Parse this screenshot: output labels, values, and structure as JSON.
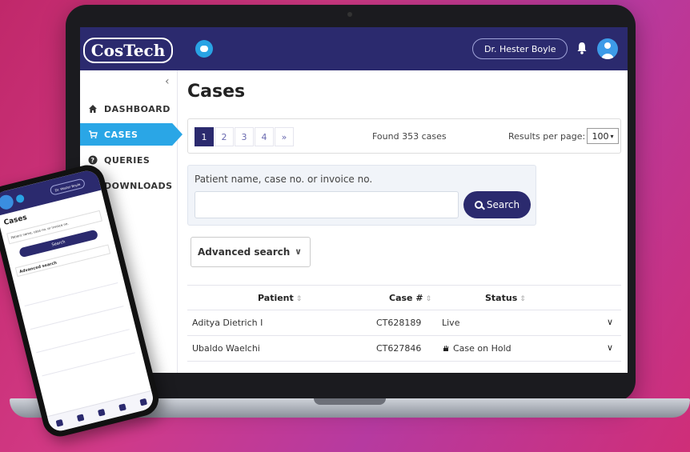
{
  "header": {
    "logo_text": "CosTech",
    "user_name": "Dr. Hester Boyle"
  },
  "sidebar": {
    "collapse_glyph": "‹",
    "items": [
      {
        "label": "DASHBOARD",
        "icon": "home-icon"
      },
      {
        "label": "CASES",
        "icon": "cart-icon",
        "active": true
      },
      {
        "label": "QUERIES",
        "icon": "question-icon"
      },
      {
        "label": "DOWNLOADS",
        "icon": "download-icon"
      }
    ]
  },
  "main": {
    "title": "Cases",
    "pagination": {
      "pages": [
        "1",
        "2",
        "3",
        "4",
        "»"
      ],
      "current": "1"
    },
    "found_text": "Found 353 cases",
    "results_per_page_label": "Results per page:",
    "results_per_page_value": "100",
    "search": {
      "label": "Patient name, case no. or invoice no.",
      "value": "",
      "button_label": "Search"
    },
    "advanced_search_label": "Advanced search",
    "table": {
      "columns": [
        "Patient",
        "Case #",
        "Status"
      ],
      "rows": [
        {
          "patient": "Aditya Dietrich I",
          "case": "CT628189",
          "status": "Live",
          "status_icon": ""
        },
        {
          "patient": "Ubaldo Waelchi",
          "case": "CT627846",
          "status": "Case on Hold",
          "status_icon": "hand-icon"
        }
      ]
    }
  },
  "phone": {
    "title": "Cases",
    "search_placeholder": "Patient name, case no. or invoice no.",
    "search_button": "Search",
    "advanced_search": "Advanced search",
    "user_name": "Dr. Hester Boyle"
  },
  "colors": {
    "navy": "#2b2a6e",
    "accent_blue": "#2aa6e6",
    "background_magenta": "#c0286a"
  }
}
